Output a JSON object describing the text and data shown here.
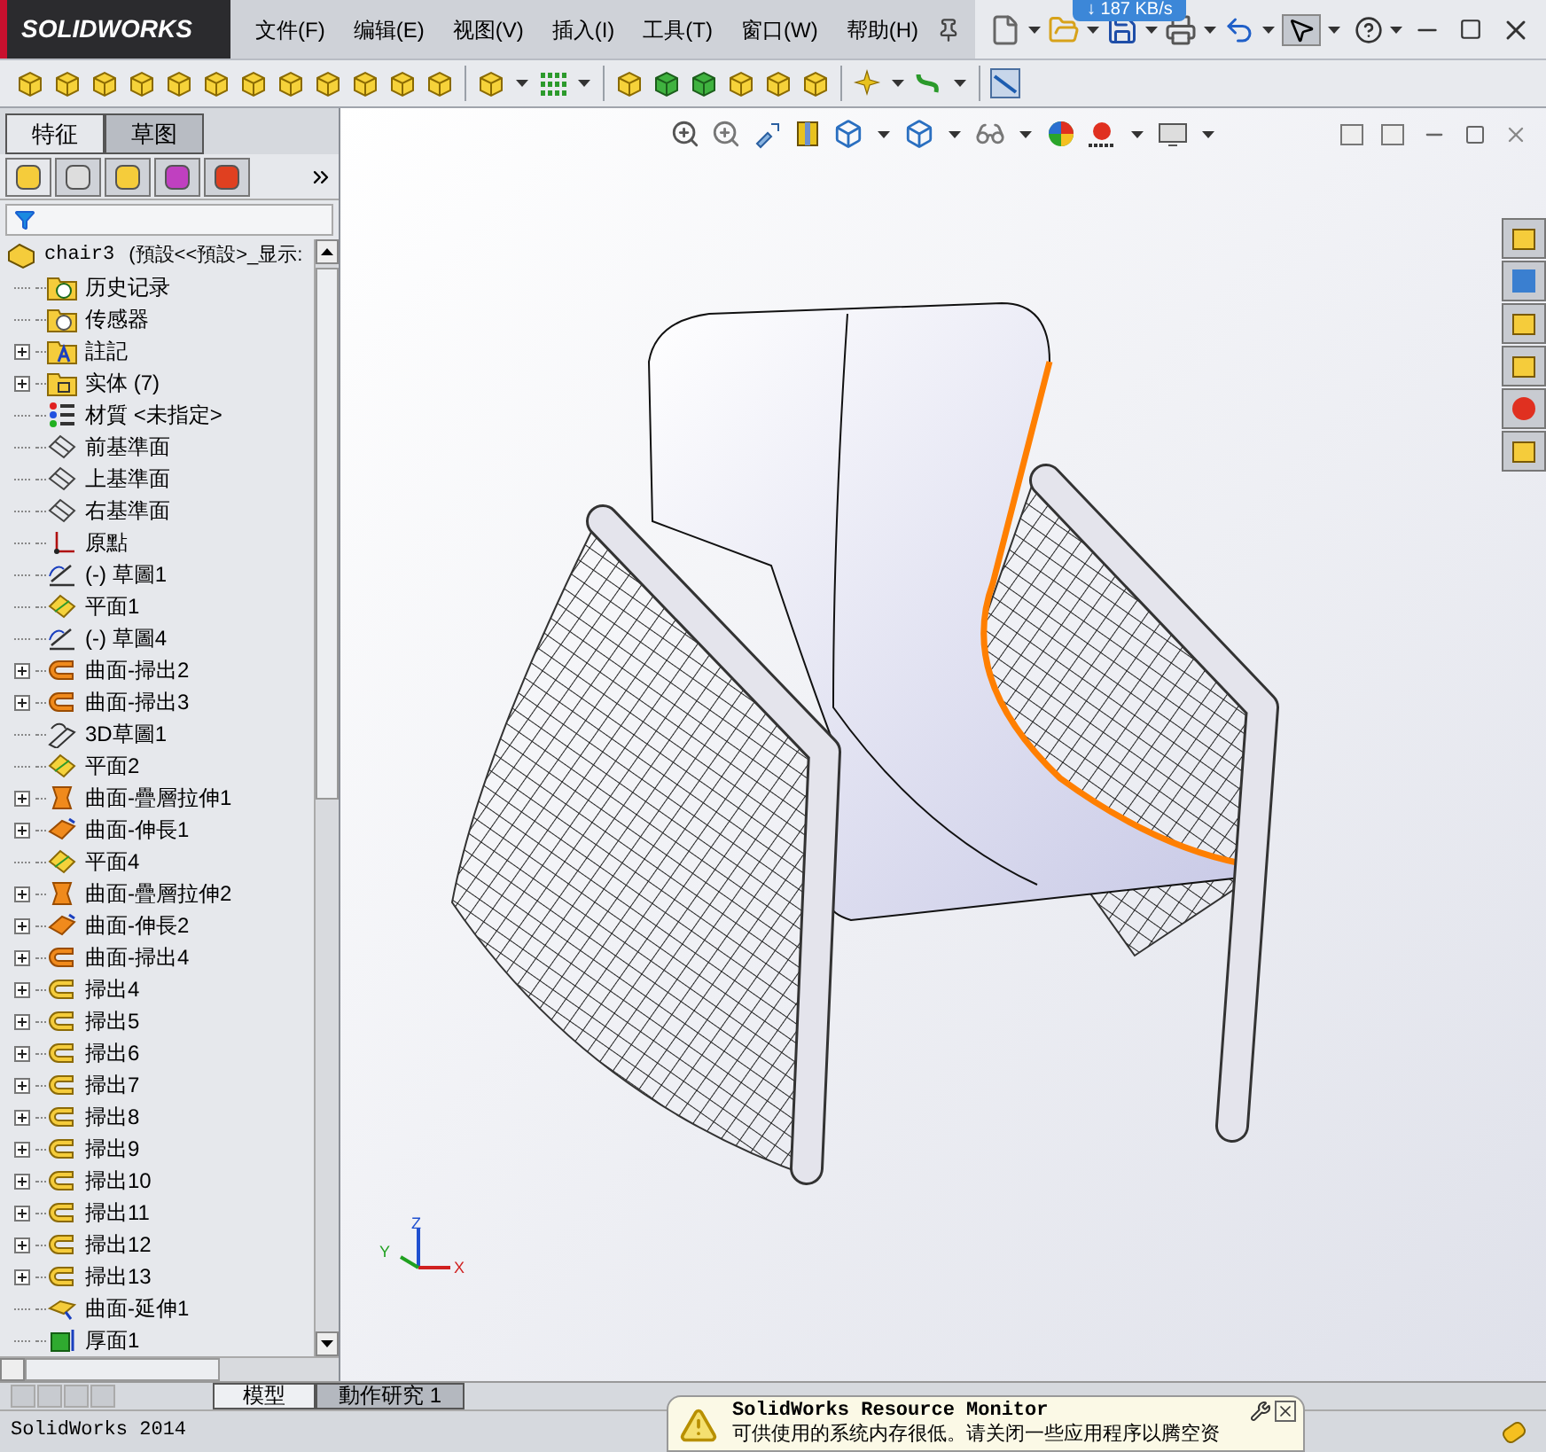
{
  "app": {
    "logo": "SOLIDWORKS"
  },
  "menu": [
    "文件(F)",
    "编辑(E)",
    "视图(V)",
    "插入(I)",
    "工具(T)",
    "窗口(W)",
    "帮助(H)"
  ],
  "speed_badge": "↓ 187 KB/s",
  "feature_tabs": [
    {
      "label": "特征",
      "selected": true
    },
    {
      "label": "草图",
      "selected": false
    }
  ],
  "tree": {
    "root": "chair3",
    "root_config": "(預設<<預設>_显示:",
    "items": [
      {
        "label": "历史记录",
        "kind": "history",
        "expandable": false
      },
      {
        "label": "传感器",
        "kind": "sensor",
        "expandable": false
      },
      {
        "label": "註記",
        "kind": "annotation",
        "expandable": true
      },
      {
        "label": "实体 (7)",
        "kind": "solid",
        "expandable": true
      },
      {
        "label": "材質 <未指定>",
        "kind": "material",
        "expandable": false
      },
      {
        "label": "前基準面",
        "kind": "plane",
        "expandable": false
      },
      {
        "label": "上基準面",
        "kind": "plane",
        "expandable": false
      },
      {
        "label": "右基準面",
        "kind": "plane",
        "expandable": false
      },
      {
        "label": "原點",
        "kind": "origin",
        "expandable": false
      },
      {
        "label": "(-) 草圖1",
        "kind": "sketch",
        "expandable": false
      },
      {
        "label": "平面1",
        "kind": "refplane",
        "expandable": false
      },
      {
        "label": "(-) 草圖4",
        "kind": "sketch",
        "expandable": false
      },
      {
        "label": "曲面-掃出2",
        "kind": "surface-sweep",
        "expandable": true
      },
      {
        "label": "曲面-掃出3",
        "kind": "surface-sweep",
        "expandable": true
      },
      {
        "label": "3D草圖1",
        "kind": "sketch3d",
        "expandable": false
      },
      {
        "label": "平面2",
        "kind": "refplane",
        "expandable": false
      },
      {
        "label": "曲面-疊層拉伸1",
        "kind": "loft",
        "expandable": true
      },
      {
        "label": "曲面-伸長1",
        "kind": "extrude",
        "expandable": true
      },
      {
        "label": "平面4",
        "kind": "refplane",
        "expandable": false
      },
      {
        "label": "曲面-疊層拉伸2",
        "kind": "loft",
        "expandable": true
      },
      {
        "label": "曲面-伸長2",
        "kind": "extrude",
        "expandable": true
      },
      {
        "label": "曲面-掃出4",
        "kind": "surface-sweep",
        "expandable": true
      },
      {
        "label": "掃出4",
        "kind": "sweep",
        "expandable": true
      },
      {
        "label": "掃出5",
        "kind": "sweep",
        "expandable": true
      },
      {
        "label": "掃出6",
        "kind": "sweep",
        "expandable": true
      },
      {
        "label": "掃出7",
        "kind": "sweep",
        "expandable": true
      },
      {
        "label": "掃出8",
        "kind": "sweep",
        "expandable": true
      },
      {
        "label": "掃出9",
        "kind": "sweep",
        "expandable": true
      },
      {
        "label": "掃出10",
        "kind": "sweep",
        "expandable": true
      },
      {
        "label": "掃出11",
        "kind": "sweep",
        "expandable": true
      },
      {
        "label": "掃出12",
        "kind": "sweep",
        "expandable": true
      },
      {
        "label": "掃出13",
        "kind": "sweep",
        "expandable": true
      },
      {
        "label": "曲面-延伸1",
        "kind": "extend",
        "expandable": false
      },
      {
        "label": "厚面1",
        "kind": "thicken",
        "expandable": false
      }
    ]
  },
  "triad": {
    "x": "X",
    "y": "Y",
    "z": "Z"
  },
  "view_tabs": [
    {
      "label": "模型",
      "selected": true
    },
    {
      "label": "動作研究 1",
      "selected": false
    }
  ],
  "status_bar": {
    "app": "SolidWorks 2014"
  },
  "notification": {
    "title": "SolidWorks Resource Monitor",
    "message": "可供使用的系统内存很低。请关闭一些应用程序以腾空资"
  }
}
